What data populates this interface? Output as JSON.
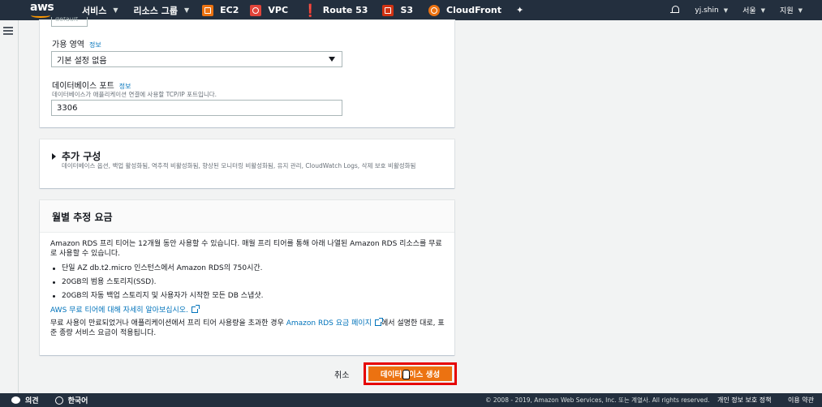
{
  "nav": {
    "brand": "aws",
    "services": "서비스",
    "resource_groups": "리소스 그룹",
    "shortcuts": [
      "EC2",
      "VPC",
      "Route 53",
      "S3",
      "CloudFront"
    ],
    "user": "yj.shin",
    "region": "서울",
    "support": "지원"
  },
  "db_settings": {
    "partial_field": "default",
    "az_label": "가용 영역",
    "az_info": "정보",
    "az_value": "기본 설정 없음",
    "port_label": "데이터베이스 포트",
    "port_info": "정보",
    "port_desc": "데이터베이스가 애플리케이션 연결에 사용할 TCP/IP 포트입니다.",
    "port_value": "3306"
  },
  "additional": {
    "title": "추가 구성",
    "desc": "데이터베이스 옵션, 백업 활성화됨, 역추적 비활성화됨, 향상된 모니터링 비활성화됨, 유지 관리, CloudWatch Logs, 삭제 보호 비활성화됨"
  },
  "cost": {
    "title": "월별 추정 요금",
    "intro": "Amazon RDS 프리 티어는 12개월 동안 사용할 수 있습니다. 매월 프리 티어를 통해 아래 나열된 Amazon RDS 리소스를 무료로 사용할 수 있습니다.",
    "items": [
      "단일 AZ db.t2.micro 인스턴스에서 Amazon RDS의 750시간.",
      "20GB의 범용 스토리지(SSD).",
      "20GB의 자동 백업 스토리지 및 사용자가 시작한 모든 DB 스냅샷."
    ],
    "learn_more": "AWS 무료 티어에 대해 자세히 알아보십시오.",
    "after_prefix": "무료 사용이 만료되었거나 애플리케이션에서 프리 티어 사용량을 초과한 경우 ",
    "pricing_link": "Amazon RDS 요금 페이지",
    "after_suffix": "에서 설명한 대로, 표준 종량 서비스 요금이 적용됩니다."
  },
  "actions": {
    "cancel": "취소",
    "create": "데이터베이스 생성"
  },
  "footer": {
    "feedback": "의견",
    "language": "한국어",
    "copyright": "© 2008 - 2019, Amazon Web Services, Inc. 또는 계열사. All rights reserved.",
    "privacy": "개인 정보 보호 정책",
    "terms": "이용 약관"
  }
}
